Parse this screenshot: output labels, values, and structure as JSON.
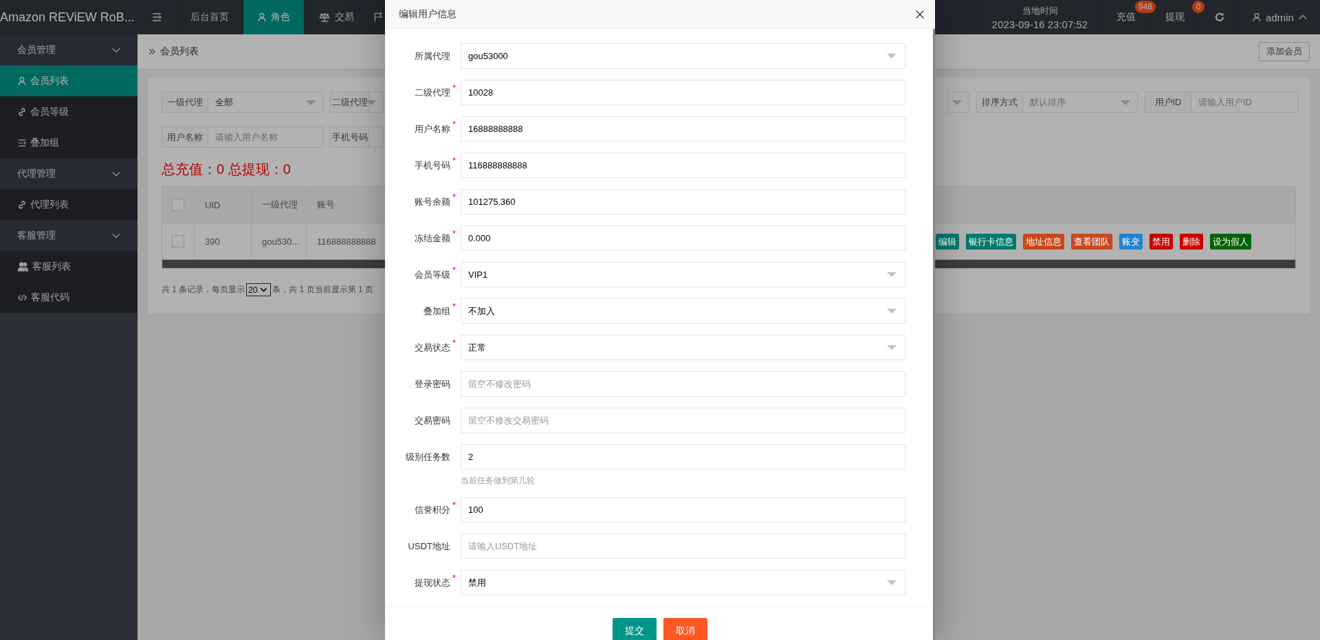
{
  "app": {
    "title": "Amazon REViEW RoB..."
  },
  "top_nav": [
    {
      "kind": "menu",
      "selected": false
    },
    {
      "kind": "link",
      "label": "后台首页",
      "selected": false
    },
    {
      "kind": "link",
      "label": "角色",
      "selected": true
    },
    {
      "kind": "link",
      "label": "交易",
      "selected": false
    },
    {
      "kind": "icon",
      "selected": false
    }
  ],
  "header_right": {
    "time_label": "当地时间",
    "time": "2023-09-16 23:07:52",
    "recharge": {
      "label": "充值",
      "badge": "948"
    },
    "withdraw": {
      "label": "提现",
      "badge": "0"
    },
    "user": {
      "name": "admin",
      "expanded": true
    }
  },
  "sidebar": [
    {
      "label": "会员管理",
      "expanded": true,
      "children": [
        {
          "label": "会员列表",
          "selected": true
        },
        {
          "label": "会员等级",
          "selected": false
        },
        {
          "label": "叠加组",
          "selected": false
        }
      ]
    },
    {
      "label": "代理管理",
      "expanded": true,
      "children": [
        {
          "label": "代理列表",
          "selected": false
        }
      ]
    },
    {
      "label": "客服管理",
      "expanded": true,
      "children": [
        {
          "label": "客服列表",
          "selected": false
        },
        {
          "label": "客服代码",
          "selected": false
        }
      ]
    }
  ],
  "breadcrumb": "会员列表",
  "add_button": "添加会员",
  "filters": [
    [
      {
        "label": "一级代理",
        "kind": "select",
        "value": "全部"
      },
      {
        "label": "二级代理",
        "kind": "select"
      },
      {
        "kind": "select"
      },
      {
        "label": "排序方式",
        "kind": "select",
        "placeholder": "默认排序"
      },
      {
        "label": "用户ID",
        "kind": "input",
        "placeholder": "请输入用户ID"
      }
    ],
    [
      {
        "label": "用户名称",
        "kind": "input",
        "placeholder": "请输入用户名称"
      },
      {
        "label": "手机号码",
        "kind": "input"
      }
    ]
  ],
  "totals": "总充值：0 总提现：0",
  "table": {
    "columns": [
      "UID",
      "一级代理",
      "账号"
    ],
    "header_checked": false,
    "rows": [
      {
        "checked": false,
        "cells": [
          "390",
          "gou530...",
          "116888888888"
        ],
        "actions": [
          {
            "label": "编辑",
            "color": "#00796b"
          },
          {
            "label": "银行卡信息",
            "color": "#00796b"
          },
          {
            "label": "地址信息",
            "color": "#c8481c"
          },
          {
            "label": "查看团队",
            "color": "#c8481c"
          },
          {
            "label": "账变",
            "color": "#1f82cf"
          },
          {
            "label": "禁用",
            "color": "#c80000"
          },
          {
            "label": "删除",
            "color": "#c80000"
          },
          {
            "label": "设为假人",
            "color": "#006400"
          }
        ]
      }
    ]
  },
  "pagination": {
    "before": "共 1 条记录，每页显示",
    "page_size": "20",
    "after": "条，共 1 页当前显示第 1 页"
  },
  "dialog": {
    "title": "编辑用户信息",
    "fields": [
      {
        "label": "所属代理",
        "kind": "select",
        "value": "gou53000"
      },
      {
        "label": "二级代理",
        "kind": "input",
        "required_mark": "*",
        "value": "10028"
      },
      {
        "label": "用户名称",
        "kind": "input",
        "required_mark": "*",
        "value": "16888888888"
      },
      {
        "label": "手机号码",
        "kind": "input",
        "required_mark": "*",
        "value": "116888888888"
      },
      {
        "label": "账号余额",
        "kind": "input",
        "required_mark": "*",
        "value": "101275.360"
      },
      {
        "label": "冻结金额",
        "kind": "input",
        "required_mark": "*",
        "value": "0.000"
      },
      {
        "label": "会员等级",
        "kind": "select",
        "required_mark": "*",
        "value": "VIP1"
      },
      {
        "label": "叠加组",
        "kind": "select",
        "required_mark": "*",
        "value": "不加入"
      },
      {
        "label": "交易状态",
        "kind": "select",
        "required_mark": "*",
        "value": "正常"
      },
      {
        "label": "登录密码",
        "kind": "input",
        "placeholder": "留空不修改密码"
      },
      {
        "label": "交易密码",
        "kind": "input",
        "placeholder": "留空不修改交易密码"
      },
      {
        "label": "级别任务数",
        "kind": "input",
        "value": "2",
        "hint": "当前任务做到第几轮"
      },
      {
        "label": "信誉积分",
        "kind": "input",
        "required_mark": "*",
        "value": "100"
      },
      {
        "label": "USDT地址",
        "kind": "input",
        "placeholder": "请输入USDT地址"
      },
      {
        "label": "提现状态",
        "kind": "select",
        "required_mark": "*",
        "value": "禁用"
      }
    ],
    "buttons": [
      {
        "label": "提交",
        "kind": "primary"
      },
      {
        "label": "取消",
        "kind": "danger"
      }
    ]
  }
}
